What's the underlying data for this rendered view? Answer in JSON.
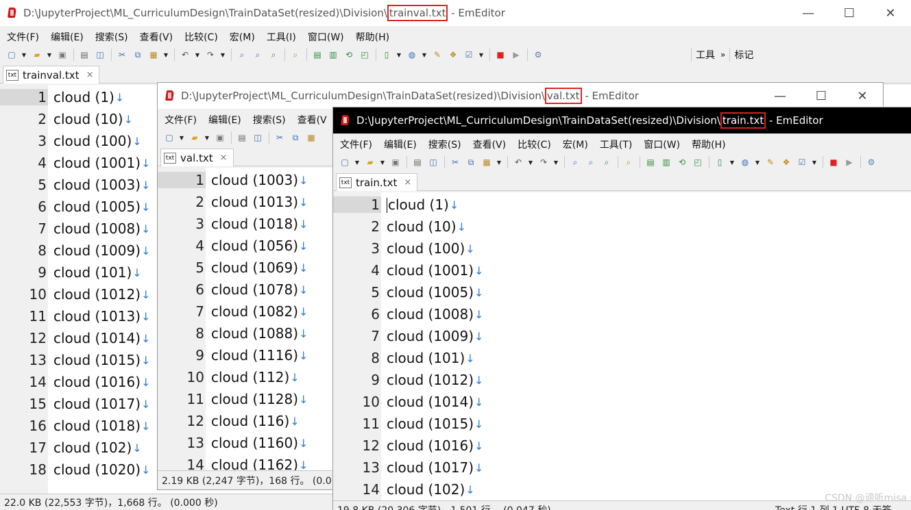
{
  "windows": {
    "trainval": {
      "title_prefix": "D:\\JupyterProject\\ML_CurriculumDesign\\TrainDataSet(resized)\\Division\\",
      "title_file": "trainval.txt",
      "title_suffix": " - EmEditor",
      "tab_label": "trainval.txt",
      "status": "22.0 KB (22,553 字节)，1,668 行。 (0.000 秒)",
      "toolbar_right": {
        "tools_label": "工具",
        "more_label": "»",
        "bookmark_label": "标记"
      },
      "lines": [
        "cloud (1)",
        "cloud (10)",
        "cloud (100)",
        "cloud (1001)",
        "cloud (1003)",
        "cloud (1005)",
        "cloud (1008)",
        "cloud (1009)",
        "cloud (101)",
        "cloud (1012)",
        "cloud (1013)",
        "cloud (1014)",
        "cloud (1015)",
        "cloud (1016)",
        "cloud (1017)",
        "cloud (1018)",
        "cloud (102)",
        "cloud (1020)"
      ]
    },
    "val": {
      "title_prefix": "D:\\JupyterProject\\ML_CurriculumDesign\\TrainDataSet(resized)\\Division\\",
      "title_file": "val.txt",
      "title_suffix": " - EmEditor",
      "tab_label": "val.txt",
      "status": "2.19 KB (2,247 字节)，168 行。 (0.01",
      "lines": [
        "cloud (1003)",
        "cloud (1013)",
        "cloud (1018)",
        "cloud (1056)",
        "cloud (1069)",
        "cloud (1078)",
        "cloud (1082)",
        "cloud (1088)",
        "cloud (1116)",
        "cloud (112)",
        "cloud (1128)",
        "cloud (116)",
        "cloud (1160)",
        "cloud (1162)"
      ]
    },
    "train": {
      "title_prefix": "D:\\JupyterProject\\ML_CurriculumDesign\\TrainDataSet(resized)\\Division\\",
      "title_file": "train.txt",
      "title_suffix": " - EmEditor",
      "tab_label": "train.txt",
      "status": "19.8 KB (20,306 字节)，1,501 行。 (0.047 秒)",
      "status_right": "Text  行 1,列 1    UTF-8 无签",
      "lines": [
        "cloud (1)",
        "cloud (10)",
        "cloud (100)",
        "cloud (1001)",
        "cloud (1005)",
        "cloud (1008)",
        "cloud (1009)",
        "cloud (101)",
        "cloud (1012)",
        "cloud (1014)",
        "cloud (1015)",
        "cloud (1016)",
        "cloud (1017)",
        "cloud (102)"
      ]
    }
  },
  "menu": {
    "full": [
      "文件(F)",
      "编辑(E)",
      "搜索(S)",
      "查看(V)",
      "比较(C)",
      "宏(M)",
      "工具(T)",
      "窗口(W)",
      "帮助(H)"
    ],
    "trainval": [
      "文件(F)",
      "编辑(E)",
      "搜索(S)",
      "查看(V)",
      "比较(C)",
      "宏(M)",
      "工具(I)",
      "窗口(W)",
      "帮助(H)"
    ],
    "val_visible": [
      "文件(F)",
      "编辑(E)",
      "搜索(S)",
      "查看(V"
    ]
  },
  "window_buttons": {
    "minimize": "—",
    "maximize": "☐",
    "close": "✕"
  },
  "tab_close": "×",
  "txt_icon_label": "txt",
  "newline_mark": "↓",
  "watermark": "CSDN @谛听misa",
  "colors": {
    "highlight_box": "#dd2222",
    "active_title": "#000000",
    "newline_arrow": "#2e7dd6"
  }
}
